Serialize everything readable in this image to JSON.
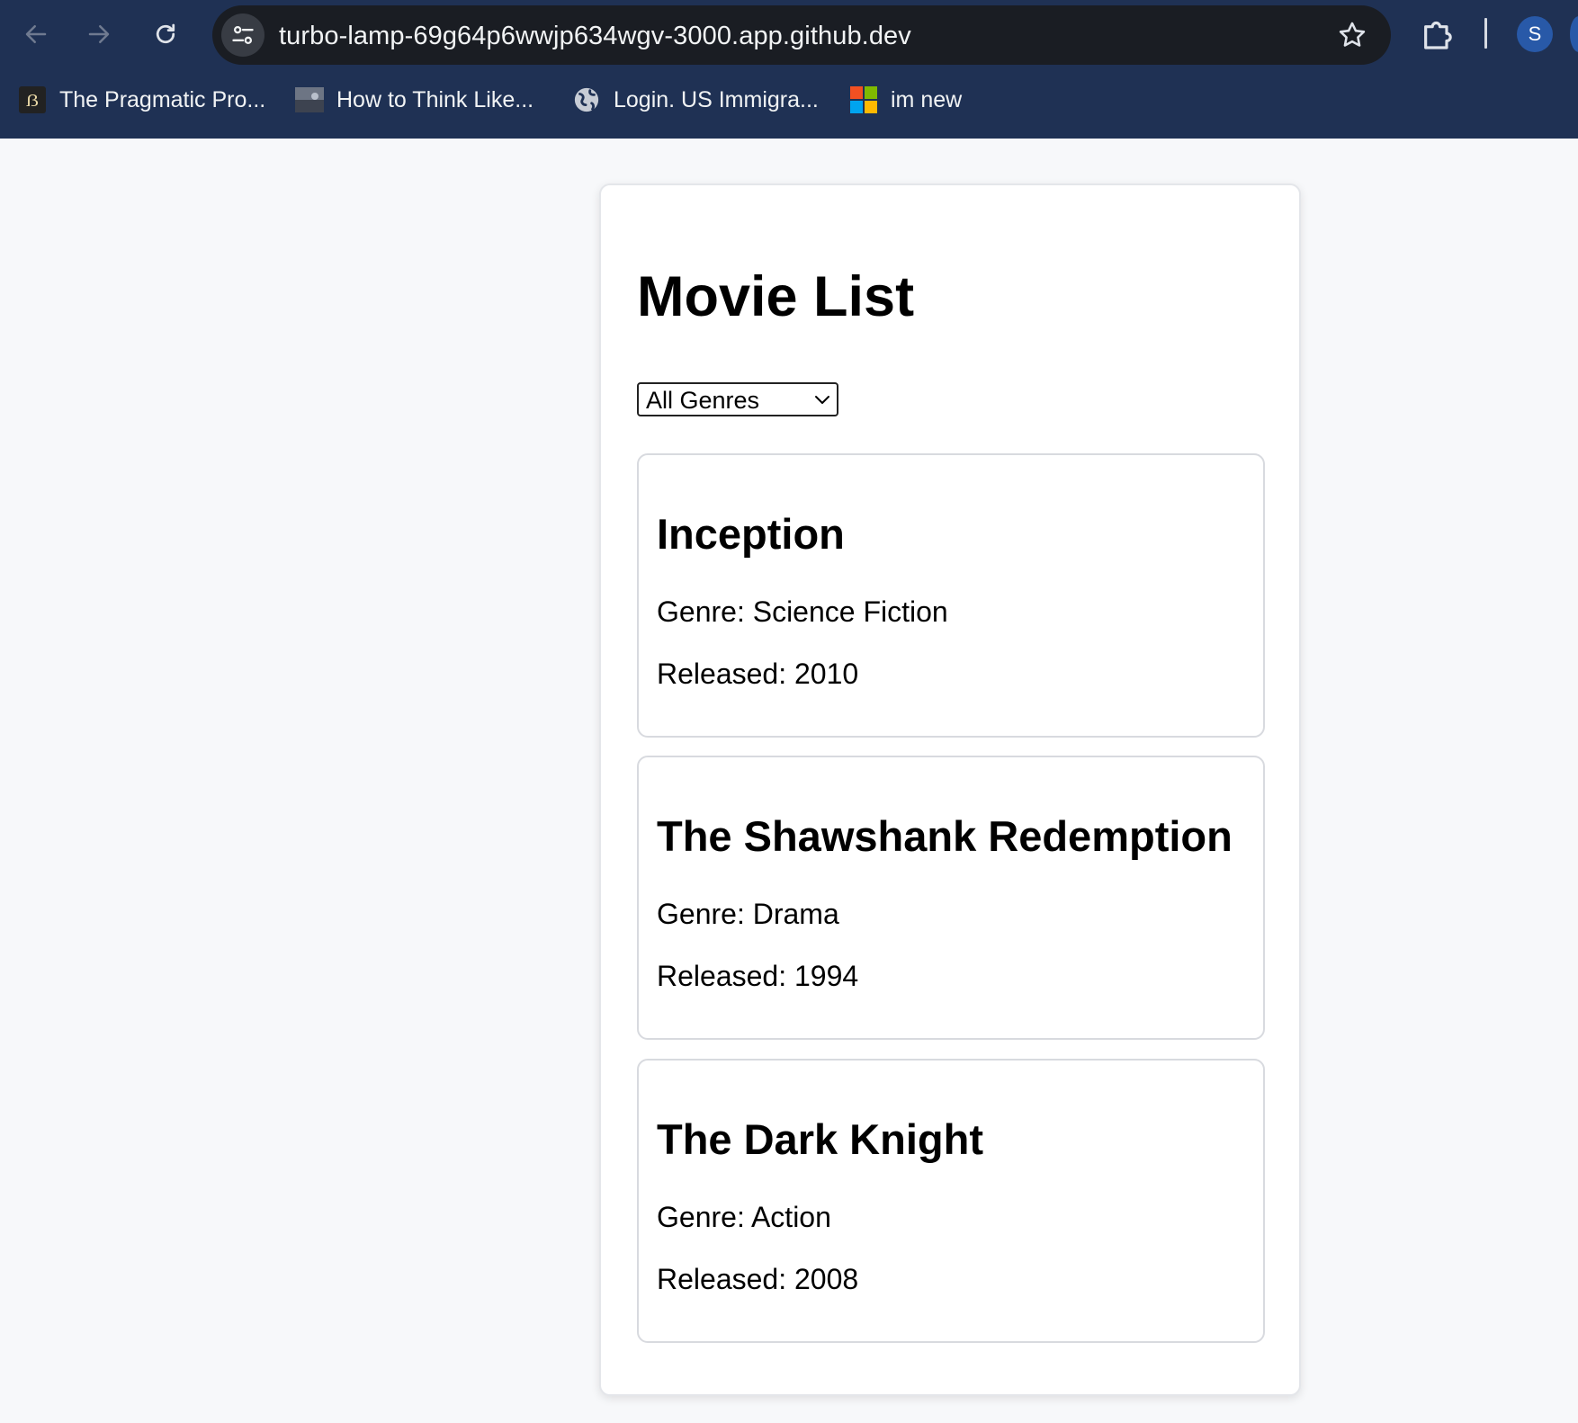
{
  "browser": {
    "url": "turbo-lamp-69g64p6wwjp634wgv-3000.app.github.dev",
    "profile_initial": "S",
    "bookmarks": [
      {
        "label": "The Pragmatic Pro...",
        "icon": "pragmatic-logo-icon"
      },
      {
        "label": "How to Think Like...",
        "icon": "thumbnail-icon"
      },
      {
        "label": "Login. US Immigra...",
        "icon": "globe-icon"
      },
      {
        "label": "im new",
        "icon": "microsoft-logo-icon"
      }
    ]
  },
  "page": {
    "title": "Movie List",
    "genre_filter": {
      "selected": "All Genres"
    },
    "movies": [
      {
        "title": "Inception",
        "genre": "Genre: Science Fiction",
        "released": "Released: 2010"
      },
      {
        "title": "The Shawshank Redemption",
        "genre": "Genre: Drama",
        "released": "Released: 1994"
      },
      {
        "title": "The Dark Knight",
        "genre": "Genre: Action",
        "released": "Released: 2008"
      }
    ]
  },
  "colors": {
    "chrome_background": "#1f3154",
    "omnibox_background": "#1a1d23",
    "page_background": "#f7f8fa",
    "avatar": "#2859a8"
  }
}
